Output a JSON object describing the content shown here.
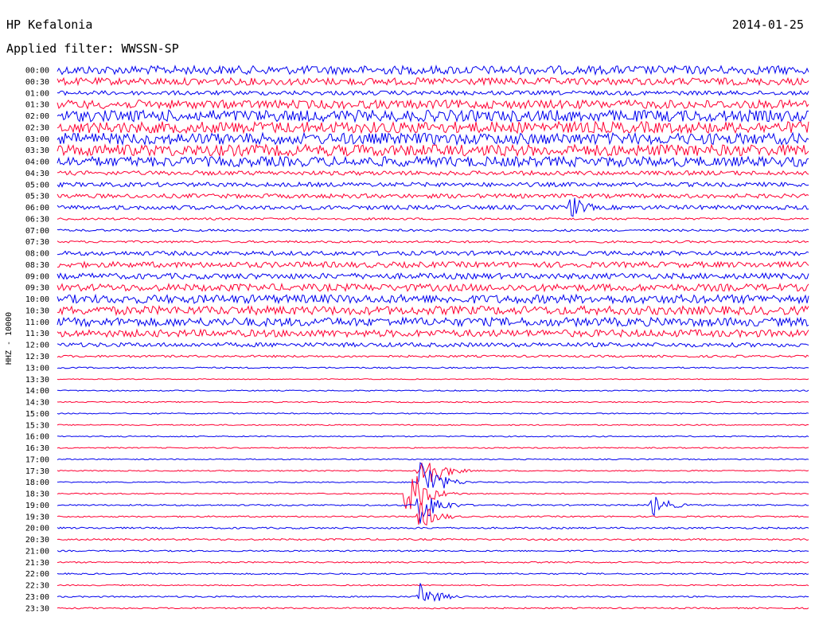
{
  "header": {
    "station": "HP Kefalonia",
    "date": "2014-01-25",
    "filter_label": "Applied filter: WWSSN-SP"
  },
  "chart_data": {
    "type": "line",
    "plot_kind": "helicorder",
    "ylabel": "HHZ - 10000",
    "row_labels": [
      "00:00",
      "00:30",
      "01:00",
      "01:30",
      "02:00",
      "02:30",
      "03:00",
      "03:30",
      "04:00",
      "04:30",
      "05:00",
      "05:30",
      "06:00",
      "06:30",
      "07:00",
      "07:30",
      "08:00",
      "08:30",
      "09:00",
      "09:30",
      "10:00",
      "10:30",
      "11:00",
      "11:30",
      "12:00",
      "12:30",
      "13:00",
      "13:30",
      "14:00",
      "14:30",
      "15:00",
      "15:30",
      "16:00",
      "16:30",
      "17:00",
      "17:30",
      "18:00",
      "18:30",
      "19:00",
      "19:30",
      "20:00",
      "20:30",
      "21:00",
      "21:30",
      "22:00",
      "22:30",
      "23:00",
      "23:30"
    ],
    "row_minutes": 30,
    "series_colors": [
      "#0000ee",
      "#ff0033"
    ],
    "trace_noise_amplitude": [
      0.6,
      0.5,
      0.3,
      0.6,
      0.8,
      0.8,
      0.8,
      0.8,
      0.7,
      0.3,
      0.3,
      0.3,
      0.3,
      0.15,
      0.15,
      0.15,
      0.3,
      0.4,
      0.4,
      0.5,
      0.6,
      0.6,
      0.6,
      0.5,
      0.3,
      0.15,
      0.1,
      0.06,
      0.08,
      0.08,
      0.08,
      0.08,
      0.08,
      0.08,
      0.08,
      0.08,
      0.08,
      0.08,
      0.1,
      0.1,
      0.12,
      0.12,
      0.1,
      0.1,
      0.1,
      0.08,
      0.1,
      0.1
    ],
    "events": [
      {
        "row": "06:00",
        "minute": 20.5,
        "amplitude": 1.8
      },
      {
        "row": "17:30",
        "minute": 14.5,
        "amplitude": 4.0
      },
      {
        "row": "18:00",
        "minute": 14.5,
        "amplitude": 4.0
      },
      {
        "row": "18:30",
        "minute": 14.0,
        "amplitude": 4.5
      },
      {
        "row": "19:00",
        "minute": 14.5,
        "amplitude": 3.2
      },
      {
        "row": "19:30",
        "minute": 14.5,
        "amplitude": 2.0
      },
      {
        "row": "19:00",
        "minute": 23.8,
        "amplitude": 1.6
      },
      {
        "row": "23:00",
        "minute": 14.5,
        "amplitude": 2.0
      }
    ],
    "grid": false,
    "legend": "none"
  }
}
